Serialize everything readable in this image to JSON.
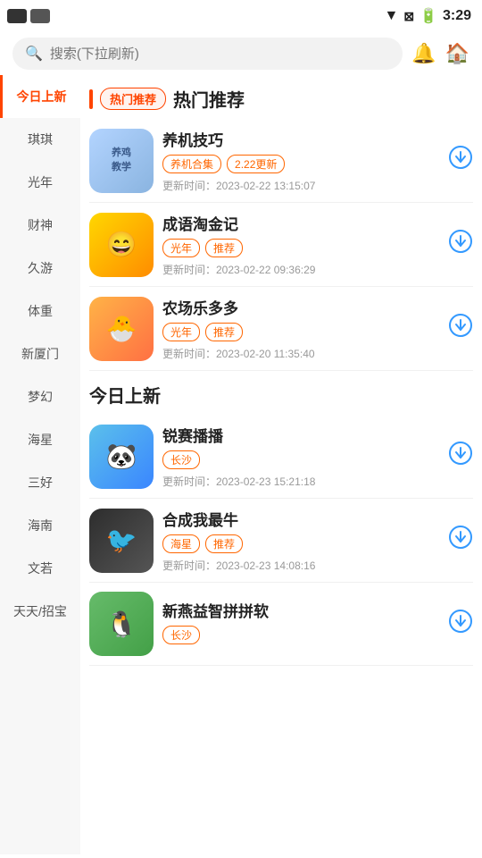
{
  "statusBar": {
    "time": "3:29"
  },
  "search": {
    "placeholder": "搜索(下拉刷新)"
  },
  "sidebar": {
    "items": [
      {
        "label": "今日上新",
        "active": true
      },
      {
        "label": "琪琪"
      },
      {
        "label": "光年"
      },
      {
        "label": "财神"
      },
      {
        "label": "久游"
      },
      {
        "label": "体重"
      },
      {
        "label": "新厦门"
      },
      {
        "label": "梦幻"
      },
      {
        "label": "海星"
      },
      {
        "label": "三好"
      },
      {
        "label": "海南"
      },
      {
        "label": "文若"
      },
      {
        "label": "天天/招宝"
      }
    ]
  },
  "hotSection": {
    "tab": "热门推荐",
    "title": "热门推荐",
    "apps": [
      {
        "name": "养机技巧",
        "tags": [
          "养机合集",
          "2.22更新"
        ],
        "time": "更新时间：2023-02-22 13:15:07",
        "iconClass": "icon-yangji",
        "iconText": "养鸡\n教学"
      },
      {
        "name": "成语淘金记",
        "tags": [
          "光年",
          "推荐"
        ],
        "time": "更新时间：2023-02-22 09:36:29",
        "iconClass": "icon-chengyu",
        "iconText": ""
      },
      {
        "name": "农场乐多多",
        "tags": [
          "光年",
          "推荐"
        ],
        "time": "更新时间：2023-02-20 11:35:40",
        "iconClass": "icon-nongchang",
        "iconText": ""
      }
    ]
  },
  "newSection": {
    "title": "今日上新",
    "apps": [
      {
        "name": "锐赛播播",
        "tags": [
          "长沙"
        ],
        "time": "更新时间：2023-02-23 15:21:18",
        "iconClass": "icon-ruisai",
        "iconText": ""
      },
      {
        "name": "合成我最牛",
        "tags": [
          "海星",
          "推荐"
        ],
        "time": "更新时间：2023-02-23 14:08:16",
        "iconClass": "icon-hecheng",
        "iconText": ""
      },
      {
        "name": "新燕益智拼拼软",
        "tags": [
          "长沙"
        ],
        "time": "",
        "iconClass": "icon-xinyan",
        "iconText": ""
      }
    ]
  },
  "downloadIcon": "⬇",
  "labels": {
    "downloadCircle": "↓"
  }
}
